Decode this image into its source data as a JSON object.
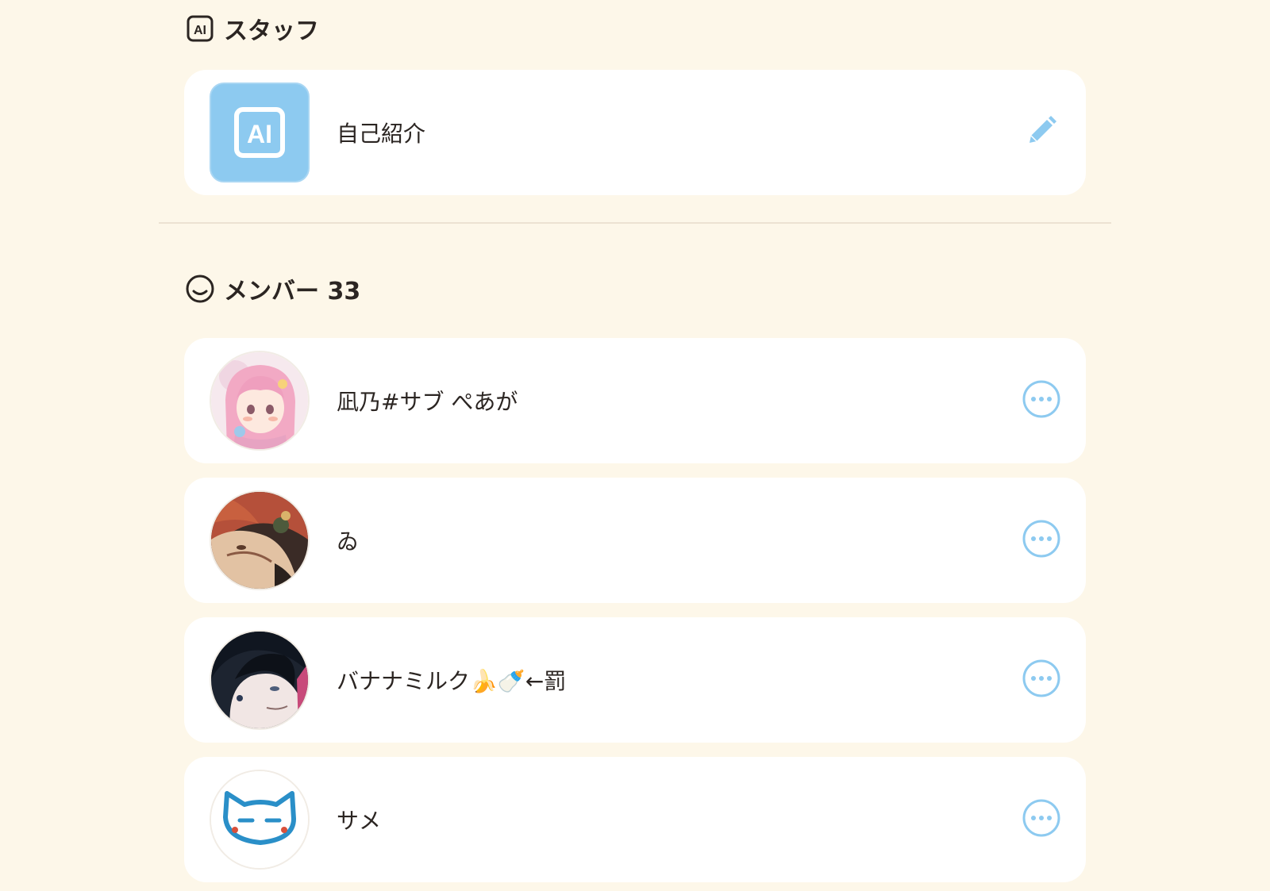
{
  "staff_section": {
    "icon": "ai-badge-icon",
    "title": "スタッフ",
    "card": {
      "avatar_icon": "ai-badge-icon",
      "label": "自己紹介",
      "action_icon": "pencil-icon"
    }
  },
  "members_section": {
    "icon": "smile-face-icon",
    "title": "メンバー 33",
    "members": [
      {
        "name": "凪乃#サブ ぺあが",
        "avatar": "pink-hair-anime-avatar",
        "action_icon": "more-options-icon"
      },
      {
        "name": "ゐ",
        "avatar": "red-hair-anime-avatar",
        "action_icon": "more-options-icon"
      },
      {
        "name": "バナナミルク🍌🍼←罰",
        "avatar": "dark-hair-anime-avatar",
        "action_icon": "more-options-icon"
      },
      {
        "name": "サメ",
        "avatar": "blue-cat-doodle-avatar",
        "action_icon": "more-options-icon"
      }
    ]
  },
  "colors": {
    "background": "#fdf7e9",
    "card": "#ffffff",
    "accent": "#8dcaf0",
    "text": "#2b2522"
  }
}
